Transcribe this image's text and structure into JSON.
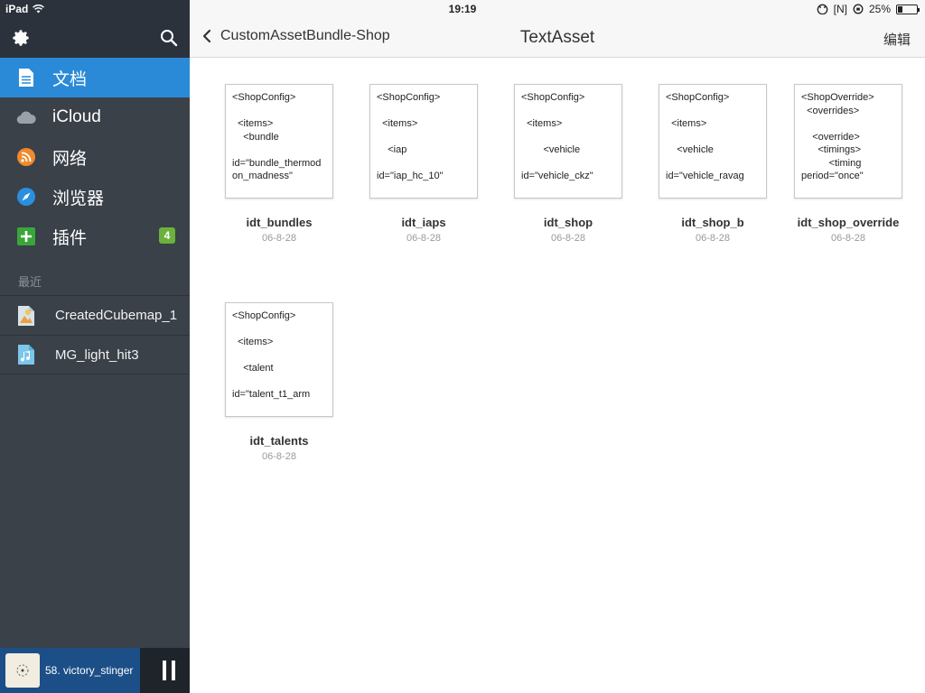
{
  "status_bar": {
    "device": "iPad",
    "time": "19:19",
    "indicator": "[N]",
    "battery_percent": "25%",
    "battery_level": 0.25
  },
  "sidebar": {
    "settings_icon": "gear-icon",
    "search_icon": "search-icon",
    "nav": [
      {
        "label": "文档",
        "icon": "document-icon",
        "active": true
      },
      {
        "label": "iCloud",
        "icon": "cloud-icon",
        "active": false
      },
      {
        "label": "网络",
        "icon": "wifi-icon",
        "active": false
      },
      {
        "label": "浏览器",
        "icon": "compass-icon",
        "active": false
      },
      {
        "label": "插件",
        "icon": "plus-icon",
        "active": false,
        "badge": "4"
      }
    ],
    "recent_label": "最近",
    "recent": [
      {
        "label": "CreatedCubemap_1",
        "icon": "image-file-icon"
      },
      {
        "label": "MG_light_hit3",
        "icon": "music-file-icon"
      }
    ]
  },
  "player": {
    "track": "58. victory_stinger",
    "pause_icon": "pause-icon"
  },
  "header": {
    "back_label": "CustomAssetBundle-Shop",
    "title": "TextAsset",
    "edit_label": "编辑"
  },
  "files": [
    {
      "name": "idt_bundles",
      "date": "06-8-28",
      "preview": "<ShopConfig>\n\n  <items>\n    <bundle\n\nid=\"bundle_thermodon_madness\""
    },
    {
      "name": "idt_iaps",
      "date": "06-8-28",
      "preview": "<ShopConfig>\n\n  <items>\n\n    <iap\n\nid=\"iap_hc_10\""
    },
    {
      "name": "idt_shop",
      "date": "06-8-28",
      "preview": "<ShopConfig>\n\n  <items>\n\n        <vehicle\n\nid=\"vehicle_ckz\""
    },
    {
      "name": "idt_shop_b",
      "date": "06-8-28",
      "preview": "<ShopConfig>\n\n  <items>\n\n    <vehicle\n\nid=\"vehicle_ravag"
    },
    {
      "name": "idt_shop_override",
      "date": "06-8-28",
      "preview": "<ShopOverride>\n  <overrides>\n\n    <override>\n      <timings>\n          <timing\nperiod=\"once\""
    },
    {
      "name": "idt_talents",
      "date": "06-8-28",
      "preview": "<ShopConfig>\n\n  <items>\n\n    <talent\n\nid=\"talent_t1_arm"
    }
  ],
  "colors": {
    "sidebar_bg": "#3a4149",
    "active_blue": "#2a8ad8",
    "badge_green": "#6ab23c",
    "player_blue": "#1c4f87"
  }
}
